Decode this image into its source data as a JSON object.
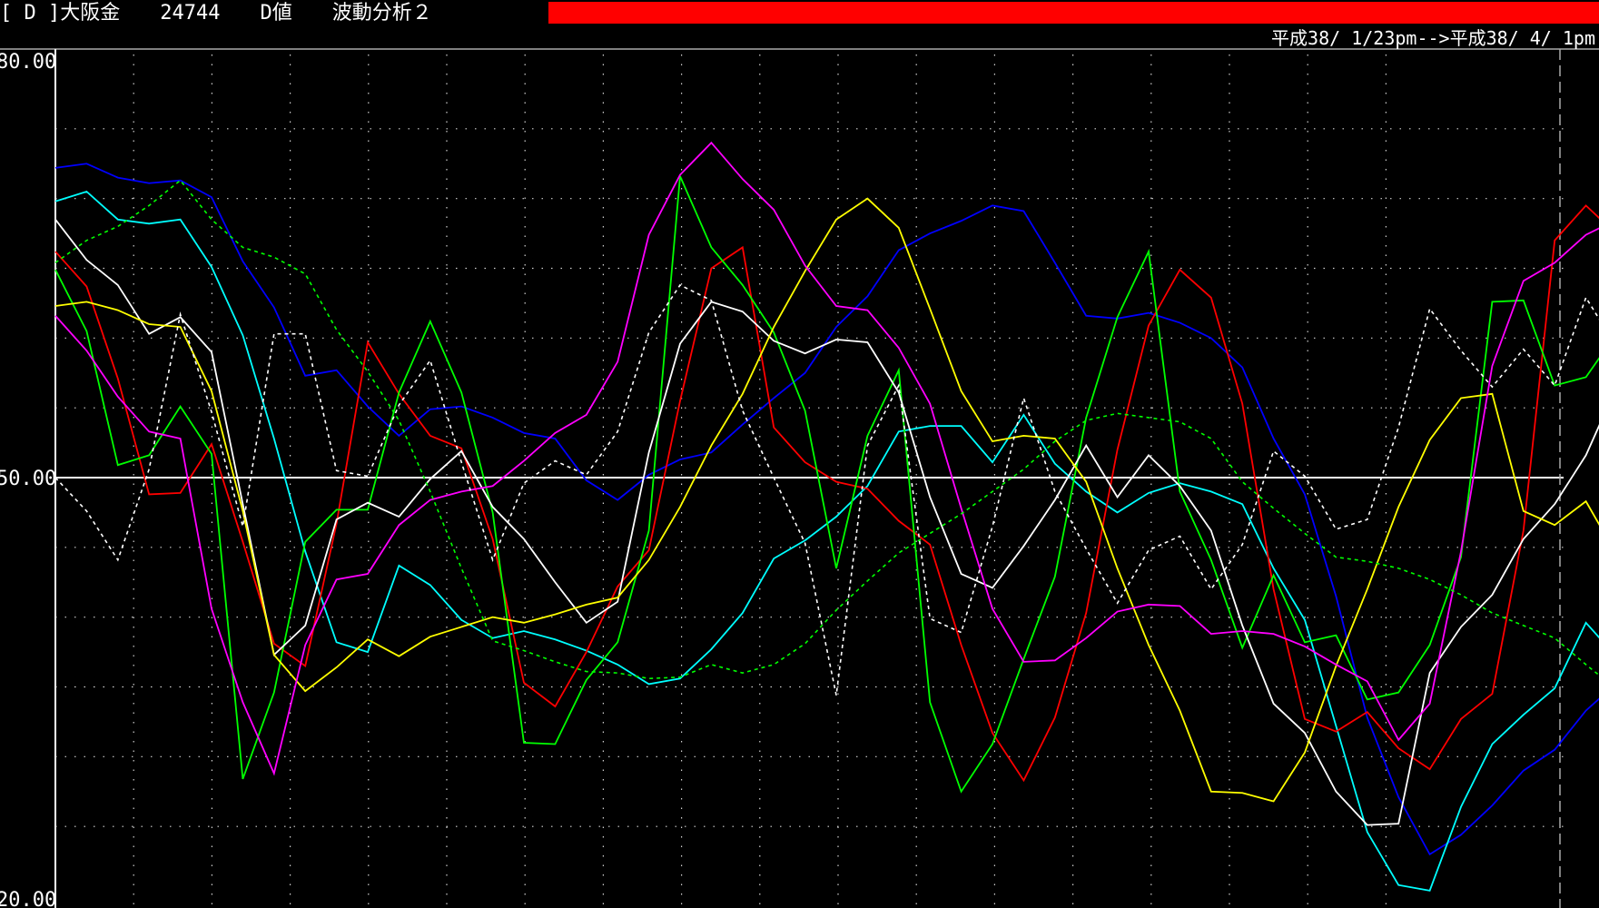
{
  "header": {
    "title": "[ D ]大阪金　　24744　　D値　　波動分析２",
    "date_range": "平成38/ 1/23pm-->平成38/ 4/ 1pm"
  },
  "colors": {
    "background": "#000000",
    "progress_bar": "#ff0000",
    "axis": "#ffffff",
    "grid": "#d0d0d0"
  },
  "chart_data": {
    "type": "line",
    "ylim": [
      20,
      80
    ],
    "x": [
      0,
      1,
      2,
      3,
      4,
      5,
      6,
      7,
      8,
      9,
      10,
      11,
      12,
      13,
      14,
      15,
      15.5,
      16,
      17,
      18,
      19,
      20,
      21,
      22,
      23,
      24,
      25,
      26,
      27,
      28,
      29,
      30,
      31,
      32,
      33,
      34,
      35,
      36,
      37,
      38,
      39,
      40,
      41,
      42,
      43,
      44,
      45,
      46,
      47,
      48,
      49,
      50
    ],
    "y_tick_labels": [
      "80.00",
      "50.00",
      "20.00"
    ],
    "y_tick_values": [
      80,
      50,
      20
    ],
    "x_label": "",
    "y_label": "",
    "grid": true,
    "series": [
      {
        "color": "#0000ff",
        "style": "solid",
        "values": [
          72.2,
          72.5,
          71.5,
          71.1,
          71.3,
          70.1,
          65.5,
          62.2,
          57.3,
          57.7,
          55.1,
          53.0,
          54.9,
          55.1,
          54.3,
          53.2,
          52.8,
          49.8,
          48.4,
          50.2,
          51.3,
          51.8,
          53.8,
          55.7,
          57.5,
          60.8,
          63.0,
          66.3,
          67.5,
          68.4,
          69.5,
          69.1,
          65.4,
          61.6,
          61.4,
          61.8,
          61.1,
          60.0,
          57.9,
          52.8,
          48.8,
          41.5,
          32.8,
          27.1,
          23.0,
          24.4,
          26.5,
          29.0,
          30.5,
          33.3,
          35.3,
          37.3
        ]
      },
      {
        "color": "#00ffff",
        "style": "solid",
        "values": [
          69.8,
          70.5,
          68.5,
          68.2,
          68.5,
          65.1,
          60.2,
          52.8,
          44.7,
          38.2,
          37.5,
          43.7,
          42.3,
          39.8,
          38.5,
          39.0,
          38.4,
          37.6,
          36.6,
          35.2,
          35.6,
          37.7,
          40.3,
          44.2,
          45.5,
          47.2,
          49.4,
          53.3,
          53.7,
          53.7,
          51.1,
          54.5,
          51.0,
          49.0,
          47.5,
          48.9,
          49.6,
          49.0,
          48.1,
          43.5,
          39.8,
          32.2,
          24.6,
          20.8,
          20.4,
          26.4,
          30.9,
          33.0,
          34.9,
          39.6,
          37.1,
          31.1
        ]
      },
      {
        "color": "#ff0000",
        "style": "solid",
        "values": [
          66.2,
          63.7,
          57.1,
          48.8,
          48.9,
          52.4,
          45.4,
          38.1,
          36.5,
          46.7,
          59.7,
          56.0,
          53.0,
          52.1,
          45.6,
          35.3,
          33.6,
          37.5,
          42.2,
          44.8,
          55.5,
          65.0,
          66.5,
          53.6,
          51.1,
          49.7,
          49.2,
          46.9,
          45.2,
          38.0,
          31.7,
          28.3,
          32.8,
          40.3,
          52.0,
          60.9,
          64.9,
          62.9,
          55.3,
          42.0,
          32.7,
          31.8,
          33.2,
          30.6,
          29.1,
          32.7,
          34.5,
          46.2,
          67.0,
          69.5,
          67.4,
          65.7
        ]
      },
      {
        "color": "#00ff00",
        "style": "solid",
        "values": [
          64.9,
          60.5,
          50.9,
          51.6,
          55.1,
          51.7,
          28.4,
          34.6,
          45.4,
          47.7,
          47.7,
          56.1,
          61.2,
          56.1,
          47.5,
          31.0,
          30.9,
          35.5,
          38.2,
          46.2,
          71.6,
          66.5,
          63.8,
          60.4,
          54.8,
          43.5,
          53.0,
          57.7,
          33.9,
          27.5,
          30.9,
          37.0,
          42.9,
          54.3,
          61.5,
          66.2,
          49.0,
          44.1,
          37.8,
          43.0,
          38.2,
          38.7,
          34.1,
          34.6,
          38.0,
          44.3,
          62.6,
          62.7,
          56.6,
          57.2,
          60.4,
          59.9
        ]
      },
      {
        "color": "#ffffff",
        "style": "solid",
        "values": [
          68.5,
          65.6,
          63.8,
          60.3,
          61.5,
          59.0,
          48.1,
          37.3,
          39.4,
          47.0,
          48.2,
          47.2,
          49.9,
          51.9,
          47.9,
          45.6,
          42.5,
          39.6,
          41.1,
          51.8,
          59.6,
          62.6,
          61.9,
          59.8,
          58.9,
          59.9,
          59.7,
          56.1,
          48.6,
          43.1,
          42.1,
          45.1,
          48.4,
          52.3,
          48.6,
          51.6,
          49.4,
          46.2,
          39.4,
          33.8,
          31.7,
          27.5,
          25.1,
          25.2,
          36.0,
          39.3,
          41.6,
          45.6,
          48.1,
          51.6,
          56.6,
          61.1
        ]
      },
      {
        "color": "#ffff00",
        "style": "solid",
        "values": [
          62.3,
          62.6,
          62.0,
          61.0,
          60.8,
          56.2,
          47.6,
          37.3,
          34.7,
          36.4,
          38.4,
          37.2,
          38.6,
          39.3,
          40.0,
          39.6,
          40.2,
          40.9,
          41.4,
          44.1,
          47.9,
          52.3,
          56.0,
          60.8,
          64.8,
          68.5,
          70.0,
          67.9,
          62.1,
          56.2,
          52.6,
          53.0,
          52.8,
          49.7,
          43.5,
          38.0,
          33.3,
          27.5,
          27.4,
          26.8,
          30.3,
          36.5,
          42.0,
          47.9,
          52.7,
          55.7,
          56.0,
          47.6,
          46.6,
          48.3,
          44.4,
          58.8
        ]
      },
      {
        "color": "#ff00ff",
        "style": "solid",
        "values": [
          61.6,
          59.1,
          55.8,
          53.3,
          52.8,
          40.6,
          33.9,
          28.8,
          38.0,
          42.7,
          43.1,
          46.6,
          48.4,
          49.0,
          49.4,
          51.2,
          53.2,
          54.5,
          58.3,
          67.4,
          71.7,
          74.0,
          71.4,
          69.2,
          65.2,
          62.3,
          62.0,
          59.3,
          55.3,
          47.8,
          40.6,
          36.8,
          36.9,
          38.5,
          40.4,
          40.9,
          40.8,
          38.8,
          39.0,
          38.8,
          37.9,
          36.6,
          35.4,
          31.2,
          33.8,
          44.7,
          58.0,
          64.1,
          65.4,
          67.4,
          68.5,
          68.1
        ]
      },
      {
        "color": "#ffffff",
        "style": "dashed",
        "values": [
          50.0,
          47.6,
          44.1,
          50.6,
          61.7,
          54.7,
          46.5,
          60.3,
          60.3,
          50.5,
          50.1,
          55.2,
          58.4,
          51.1,
          44.1,
          49.6,
          51.2,
          50.2,
          53.3,
          60.4,
          63.8,
          62.7,
          54.8,
          50.0,
          45.3,
          34.4,
          52.3,
          56.6,
          39.9,
          38.9,
          46.5,
          55.7,
          49.0,
          44.9,
          41.0,
          44.8,
          45.8,
          42.0,
          45.2,
          51.9,
          50.1,
          46.3,
          47.0,
          53.6,
          62.1,
          59.1,
          56.5,
          59.2,
          56.6,
          62.9,
          59.3,
          60.3
        ]
      },
      {
        "color": "#00ff00",
        "style": "dashed",
        "values": [
          65.4,
          67.0,
          68.0,
          69.5,
          71.3,
          68.5,
          66.5,
          65.8,
          64.6,
          60.6,
          57.6,
          54.1,
          49.0,
          43.5,
          38.3,
          37.6,
          36.8,
          36.1,
          36.0,
          35.6,
          35.7,
          36.6,
          36.0,
          36.6,
          38.1,
          40.5,
          42.6,
          44.6,
          46.0,
          47.4,
          49.0,
          50.6,
          52.6,
          54.1,
          54.6,
          54.3,
          54.0,
          52.8,
          49.7,
          47.8,
          46.0,
          44.3,
          44.0,
          43.5,
          42.7,
          41.6,
          40.3,
          39.4,
          38.5,
          36.6,
          34.8
        ]
      }
    ]
  }
}
